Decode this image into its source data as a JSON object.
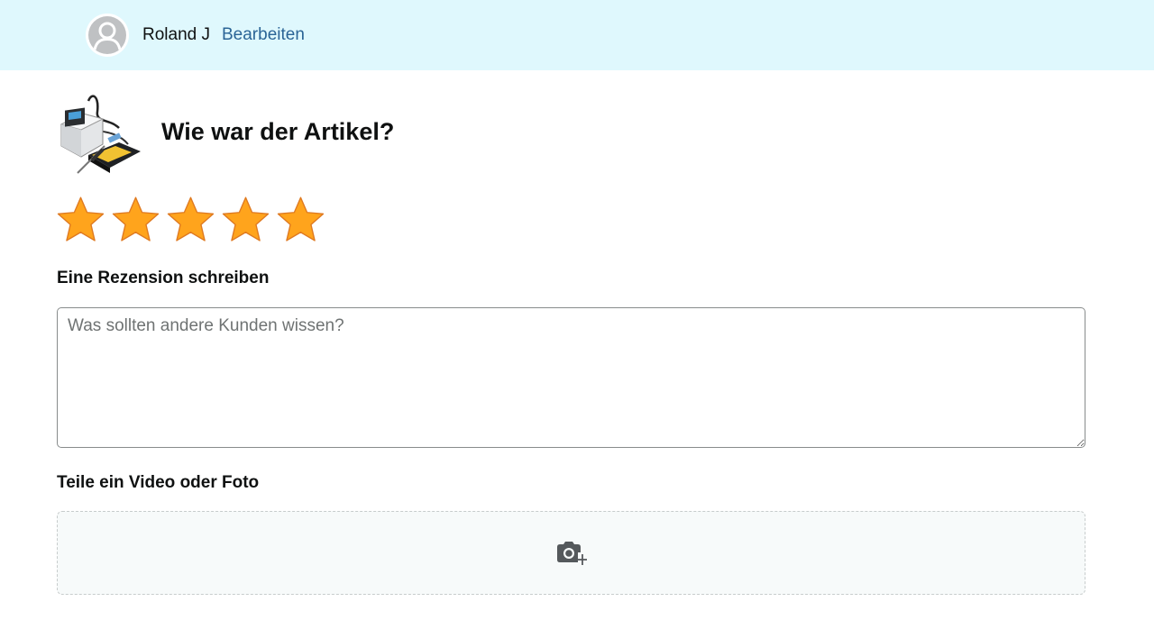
{
  "header": {
    "user_name": "Roland J",
    "edit_label": "Bearbeiten"
  },
  "product": {
    "image_icon": "soldering-station-product-image",
    "question": "Wie war der Artikel?"
  },
  "rating": {
    "value": 5,
    "max": 5,
    "star_color": "#ffa41c",
    "star_icon": "star-icon"
  },
  "review": {
    "label": "Eine Rezension schreiben",
    "placeholder": "Was sollten andere Kunden wissen?",
    "value": ""
  },
  "media": {
    "label": "Teile ein Video oder Foto",
    "upload_icon": "camera-add-icon"
  },
  "colors": {
    "header_bg": "#dff8fd",
    "link": "#2a6496",
    "upload_bg": "#f7fafa"
  }
}
